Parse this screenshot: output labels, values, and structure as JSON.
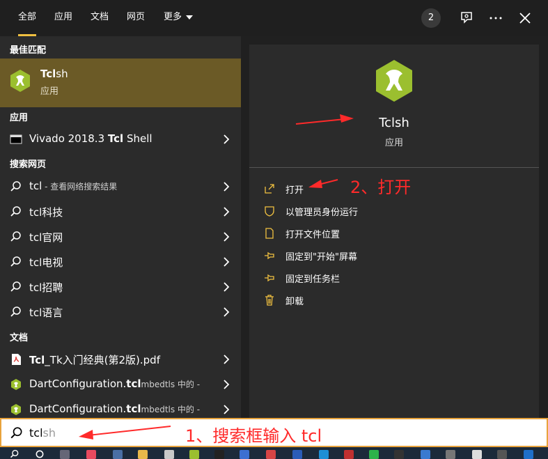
{
  "tabs": [
    {
      "label": "全部",
      "active": true
    },
    {
      "label": "应用"
    },
    {
      "label": "文档"
    },
    {
      "label": "网页"
    },
    {
      "label": "更多"
    }
  ],
  "top_right": {
    "badge": "2",
    "icons": [
      "feedback-icon",
      "more-icon",
      "close-icon"
    ]
  },
  "left": {
    "best_match_header": "最佳匹配",
    "best": {
      "name_bold": "Tcl",
      "name_rest": "sh",
      "type": "应用"
    },
    "apps_header": "应用",
    "apps": [
      {
        "pre": "Vivado 2018.3 ",
        "bold": "Tcl",
        "post": " Shell"
      }
    ],
    "web_header": "搜索网页",
    "web": [
      {
        "main": "tcl",
        "suffix": " - 查看网络搜索结果"
      },
      {
        "main": "tcl科技"
      },
      {
        "main": "tcl官网"
      },
      {
        "main": "tcl电视"
      },
      {
        "main": "tcl招聘"
      },
      {
        "main": "tcl语言"
      }
    ],
    "docs_header": "文档",
    "docs": [
      {
        "bold": "Tcl",
        "rest": "_Tk入门经典(第2版).pdf"
      },
      {
        "pre": "DartConfiguration.",
        "bold": "tcl",
        "rest": "mbedtls 中的 -"
      },
      {
        "pre": "DartConfiguration.",
        "bold": "tcl",
        "rest": "mbedtls 中的 -"
      }
    ]
  },
  "right": {
    "app_name": "Tclsh",
    "app_type": "应用",
    "actions": [
      {
        "label": "打开",
        "icon": "open-icon"
      },
      {
        "label": "以管理员身份运行",
        "icon": "shield-icon"
      },
      {
        "label": "打开文件位置",
        "icon": "folder-icon"
      },
      {
        "label": "固定到\"开始\"屏幕",
        "icon": "pin-icon"
      },
      {
        "label": "固定到任务栏",
        "icon": "pin-icon"
      },
      {
        "label": "卸载",
        "icon": "trash-icon"
      }
    ]
  },
  "search": {
    "typed": "tcl",
    "suggest": "sh"
  },
  "annotations": {
    "step1": "1、搜索框输入 tcl",
    "step2": "2、打开",
    "color": "#ff2a2a"
  },
  "colors": {
    "accent": "#f0c040",
    "best_match_bg": "#6b5a26",
    "search_border": "#e8a33c"
  }
}
